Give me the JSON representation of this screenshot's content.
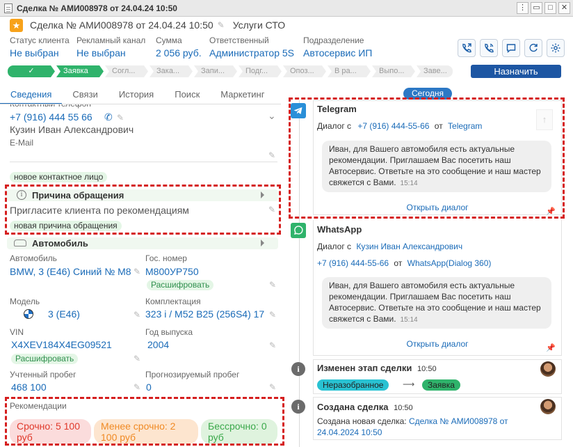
{
  "window": {
    "title": "Сделка № АМИ008978 от 24.04.24 10:50"
  },
  "header": {
    "deal_title": "Сделка № АМИ008978 от 24.04.24 10:50",
    "service": "Услуги СТО"
  },
  "fields": [
    {
      "label": "Статус клиента",
      "value": "Не выбран"
    },
    {
      "label": "Рекламный канал",
      "value": "Не выбран"
    },
    {
      "label": "Сумма",
      "value": "2 056 руб."
    },
    {
      "label": "Ответственный",
      "value": "Администратор 5S"
    },
    {
      "label": "Подразделение",
      "value": "Автосервис ИП"
    }
  ],
  "stages": [
    "✓",
    "Заявка",
    "Согл...",
    "Зака...",
    "Запи...",
    "Подг...",
    "Опоз...",
    "В ра...",
    "Выпо...",
    "Заве..."
  ],
  "assign_button": "Назначить",
  "tabs": [
    "Сведения",
    "Связи",
    "История",
    "Поиск",
    "Маркетинг"
  ],
  "contact": {
    "label": "Контактный телефон",
    "phone": "+7 (916) 444 55 66",
    "name": "Кузин Иван Александрович",
    "email_label": "E-Mail",
    "new_contact": "новое контактное лицо"
  },
  "reason": {
    "title": "Причина обращения",
    "value": "Пригласите клиента по рекомендациям",
    "new_reason": "новая причина обращения"
  },
  "car": {
    "title": "Автомобиль",
    "car_label": "Автомобиль",
    "car_value": "BMW, 3 (E46) Синий № М8",
    "plate_label": "Гос. номер",
    "plate_value": "М800УР750",
    "decode": "Расшифровать",
    "model_label": "Модель",
    "model_value": "3 (E46)",
    "trim_label": "Комплектация",
    "trim_value": "323 i / M52 B25 (256S4) 17",
    "vin_label": "VIN",
    "vin_value": "X4XEV184X4EG09521",
    "vin_decode": "Расшифровать",
    "year_label": "Год выпуска",
    "year_value": "2004",
    "mileage_label": "Учтенный пробег",
    "mileage_value": "468 100",
    "forecast_label": "Прогнозируемый пробег",
    "forecast_value": "0"
  },
  "recommendations": {
    "label": "Рекомендации",
    "urgent": "Срочно: 5 100 руб",
    "less_urgent": "Менее срочно: 2 100 руб",
    "not_urgent": "Бессрочно: 0 руб"
  },
  "timeline": {
    "today": "Сегодня",
    "telegram": {
      "title": "Telegram",
      "dialog_prefix": "Диалог с",
      "phone": "+7 (916) 444-55-66",
      "from_word": "от",
      "source": "Telegram",
      "message": "Иван, для Вашего автомобиля есть актуальные рекомендации. Приглашаем Вас посетить наш Автосервис. Ответьте на это сообщение и наш мастер свяжется с Вами.",
      "time": "15:14",
      "open": "Открыть диалог"
    },
    "whatsapp": {
      "title": "WhatsApp",
      "dialog_prefix": "Диалог с",
      "name": "Кузин Иван Александрович",
      "phone": "+7 (916) 444-55-66",
      "from_word": "от",
      "source": "WhatsApp(Dialog 360)",
      "message": "Иван, для Вашего автомобиля есть актуальные рекомендации. Приглашаем Вас посетить наш Автосервис. Ответьте на это сообщение и наш мастер свяжется с Вами.",
      "time": "15:14",
      "open": "Открыть диалог"
    },
    "stage_change": {
      "title": "Изменен этап сделки",
      "time": "10:50",
      "from": "Неразобранное",
      "to": "Заявка"
    },
    "created": {
      "title": "Создана сделка",
      "time": "10:50",
      "text": "Создана новая сделка:",
      "link": "Сделка № АМИ008978 от 24.04.2024 10:50"
    }
  },
  "colors": {
    "accent": "#1a6bb8",
    "green": "#2fb36b",
    "highlight": "#d51f1f",
    "assign": "#1d56a3"
  }
}
